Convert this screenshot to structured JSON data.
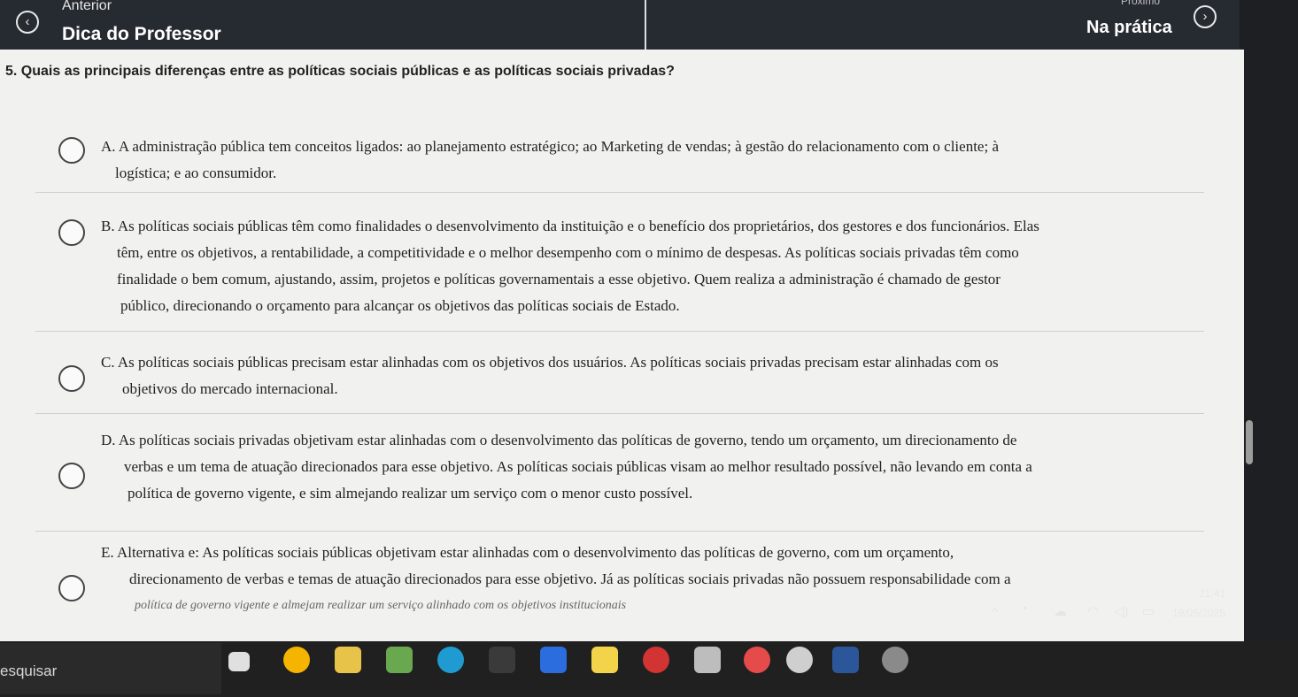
{
  "nav": {
    "prev_small": "Anterior",
    "prev_big": "Dica do Professor",
    "next_small": "Próximo",
    "next_big": "Na prática",
    "prev_icon": "chevron-left-icon",
    "next_icon": "chevron-right-icon"
  },
  "question": "5. Quais as principais diferenças entre as políticas sociais públicas e as políticas sociais privadas?",
  "options": [
    {
      "lines": [
        "A. A administração pública tem conceitos ligados: ao planejamento estratégico; ao Marketing de vendas; à gestão do relacionamento com o cliente; à",
        "logística; e ao consumidor."
      ]
    },
    {
      "lines": [
        "B. As políticas sociais públicas têm como finalidades o desenvolvimento da instituição e o benefício dos proprietários, dos gestores e dos funcionários. Elas",
        "têm, entre os objetivos, a rentabilidade, a competitividade e o melhor desempenho com o mínimo de despesas. As políticas sociais privadas têm como",
        "finalidade o bem comum, ajustando, assim, projetos e políticas governamentais a esse objetivo. Quem realiza a administração é chamado de gestor",
        "público, direcionando o orçamento para alcançar os objetivos das políticas sociais de Estado."
      ]
    },
    {
      "lines": [
        "C. As políticas sociais públicas precisam estar alinhadas com os objetivos dos usuários. As políticas sociais privadas precisam estar alinhadas com os",
        "objetivos do mercado internacional."
      ]
    },
    {
      "lines": [
        "D. As políticas sociais privadas objetivam estar alinhadas com o desenvolvimento das políticas de governo, tendo um orçamento, um direcionamento de",
        "verbas e um tema de atuação direcionados para esse objetivo. As políticas sociais públicas visam ao melhor resultado possível, não levando em conta a",
        "política de governo vigente, e sim almejando realizar um serviço com o menor custo possível."
      ]
    },
    {
      "lines": [
        "E. Alternativa e: As políticas sociais públicas objetivam estar alinhadas com o desenvolvimento das políticas de governo, com um orçamento,",
        "direcionamento de verbas e temas de atuação direcionados para esse objetivo. Já as políticas sociais privadas não possuem responsabilidade com a",
        "política de governo vigente e almejam realizar um serviço alinhado com os objetivos institucionais"
      ]
    }
  ],
  "taskbar": {
    "search_label": "esquisar",
    "time": "21:41",
    "date": "19/05/2025",
    "apps": [
      "task-view-icon",
      "chrome-icon",
      "file-explorer-icon",
      "minecraft-icon",
      "edge-icon",
      "calculator-icon",
      "canva-icon",
      "sticky-notes-icon",
      "opera-icon",
      "files-icon",
      "opera-gx-icon",
      "headset-icon",
      "word-icon",
      "settings-icon"
    ],
    "tray": [
      "chevron-up-icon",
      "copilot-icon",
      "cloud-icon",
      "wifi-icon",
      "volume-icon",
      "battery-icon"
    ]
  },
  "colors": {
    "topbar": "#262a31",
    "content_bg": "#f1f1ef",
    "taskbar": "#202020"
  }
}
